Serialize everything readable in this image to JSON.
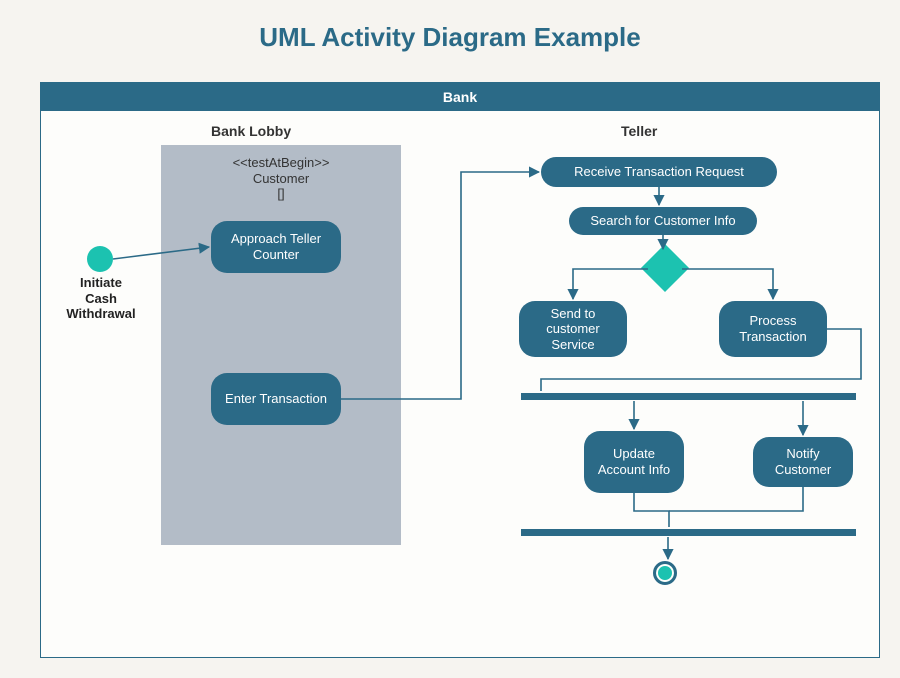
{
  "title": "UML Activity Diagram Example",
  "pool": {
    "name": "Bank"
  },
  "lanes": {
    "lobby": "Bank Lobby",
    "teller": "Teller"
  },
  "partition": {
    "stereotype": "<<testAtBegin>>",
    "name": "Customer",
    "guard": "[]"
  },
  "start": {
    "label": "Initiate\nCash\nWithdrawal"
  },
  "activities": {
    "approach": "Approach Teller Counter",
    "enter": "Enter Transaction",
    "receive": "Receive Transaction Request",
    "search": "Search for Customer Info",
    "sendSvc": "Send to customer Service",
    "process": "Process Transaction",
    "update": "Update Account Info",
    "notify": "Notify Customer"
  },
  "colors": {
    "primary": "#2b6a87",
    "accent": "#1cc2b0",
    "partition": "#b3bcc7"
  }
}
